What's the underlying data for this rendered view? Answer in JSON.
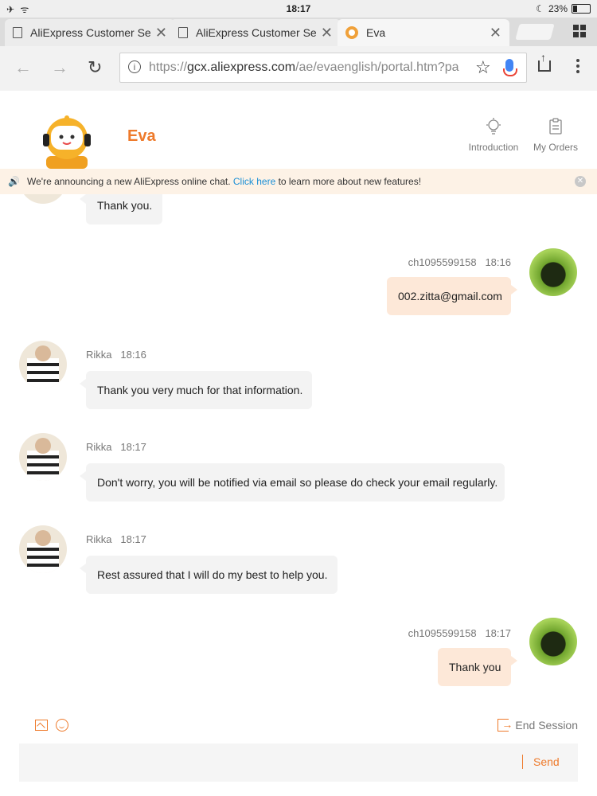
{
  "status_bar": {
    "left": "✈ ᯤ",
    "time": "18:17",
    "moon": "☾",
    "battery": "23%"
  },
  "browser": {
    "tabs": [
      {
        "title": "AliExpress Customer Se",
        "close": "✕"
      },
      {
        "title": "AliExpress Customer Se",
        "close": "✕"
      },
      {
        "title": "Eva",
        "close": "✕"
      }
    ],
    "url_scheme": "https://",
    "url_host": "gcx.aliexpress.com",
    "url_path": "/ae/evaenglish/portal.htm?pa",
    "back": "←",
    "forward": "→",
    "reload": "↻",
    "star": "☆"
  },
  "header": {
    "agent_name": "Eva",
    "introduction_label": "Introduction",
    "my_orders_label": "My Orders"
  },
  "notice": {
    "speaker": "🔊",
    "text_before": "We're announcing a new AliExpress online chat. ",
    "link": "Click here",
    "text_after": " to learn more about new features!",
    "close": "✕"
  },
  "messages": [
    {
      "side": "agent",
      "author": "",
      "time": "",
      "text": "Thank you."
    },
    {
      "side": "user",
      "author": "ch1095599158",
      "time": "18:16",
      "text": "002.zitta@gmail.com"
    },
    {
      "side": "agent",
      "author": "Rikka",
      "time": "18:16",
      "text": "Thank you very much for that information."
    },
    {
      "side": "agent",
      "author": "Rikka",
      "time": "18:17",
      "text": "Don't worry, you will be notified via email so please do check your email regularly."
    },
    {
      "side": "agent",
      "author": "Rikka",
      "time": "18:17",
      "text": "Rest assured that I will do my best to help you."
    },
    {
      "side": "user",
      "author": "ch1095599158",
      "time": "18:17",
      "text": "Thank you"
    }
  ],
  "footer": {
    "end_session_label": "End Session",
    "send_label": "Send"
  },
  "colors": {
    "accent": "#ee7a2b",
    "user_bubble": "#fde8d8",
    "agent_bubble": "#f3f3f3",
    "link": "#1a8fd6"
  }
}
